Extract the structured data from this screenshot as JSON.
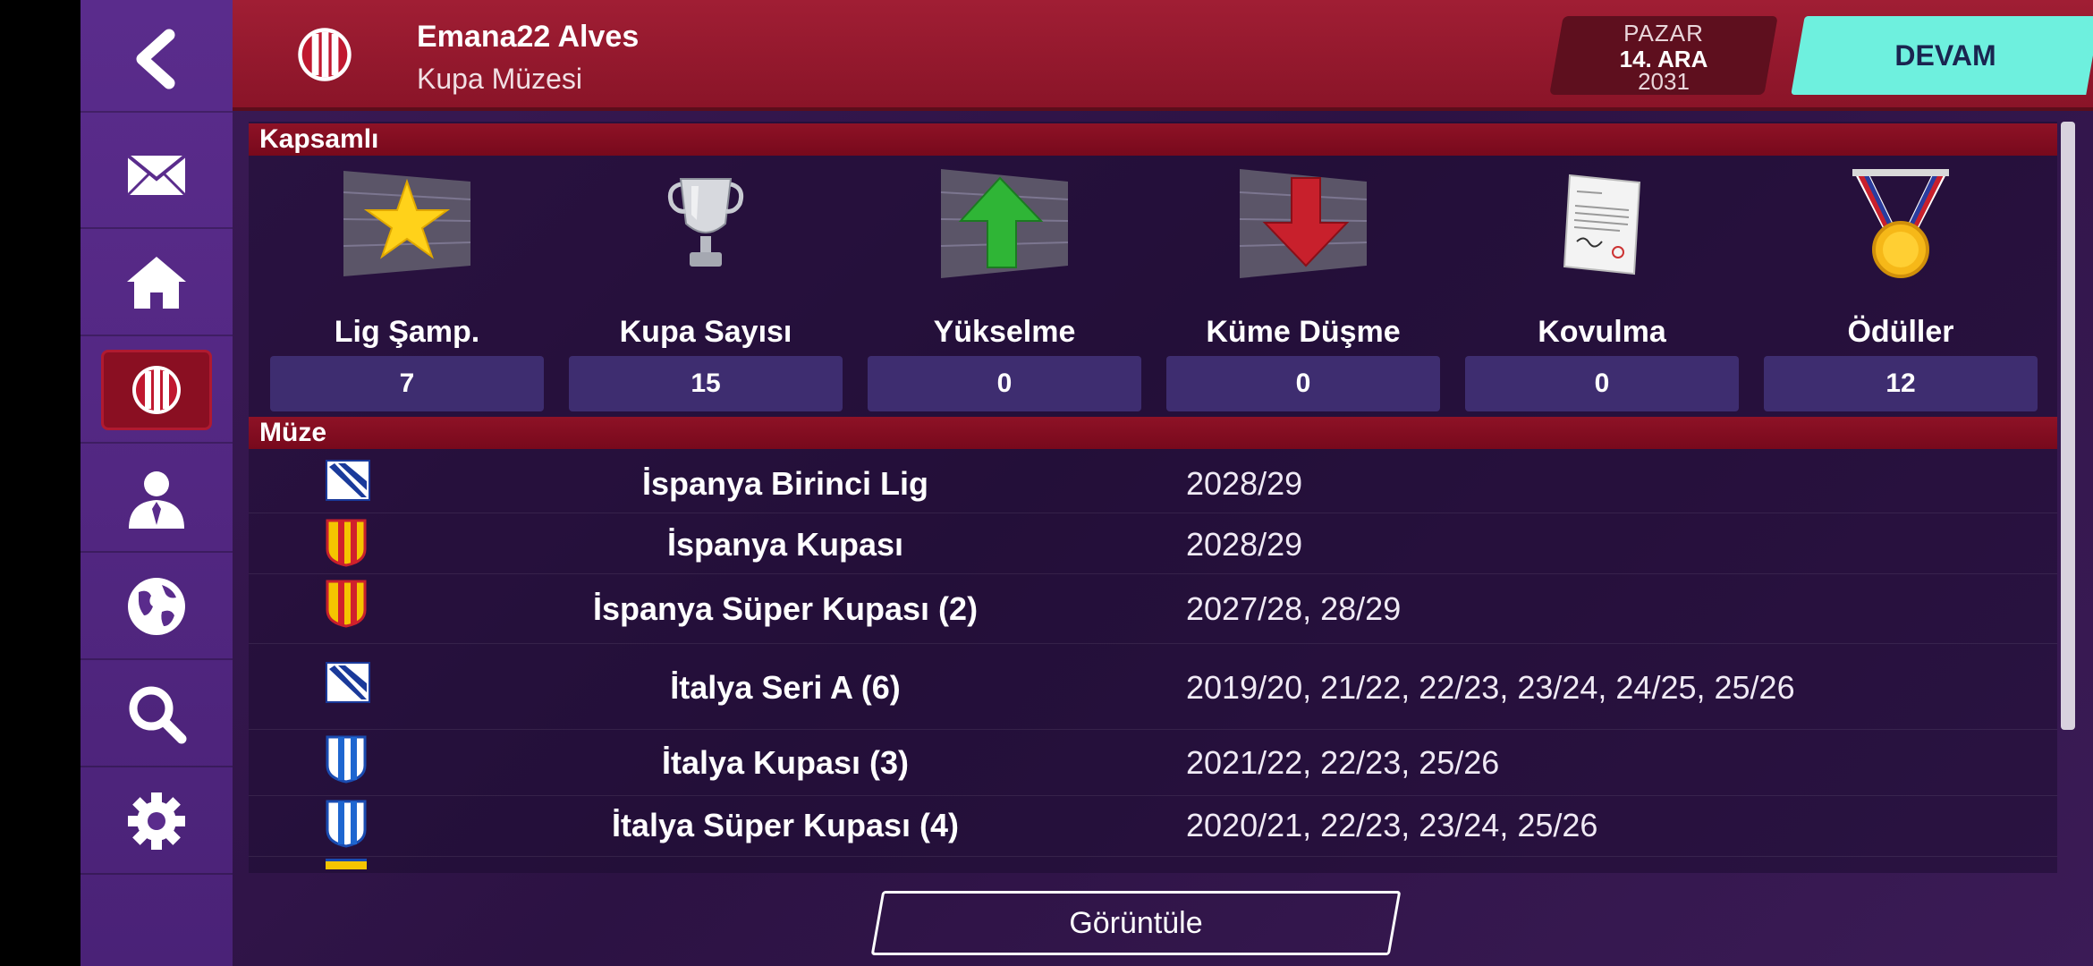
{
  "header": {
    "manager_name": "Emana22 Alves",
    "page_subtitle": "Kupa Müzesi",
    "date": {
      "day": "PAZAR",
      "date": "14. ARA",
      "year": "2031"
    },
    "continue_label": "DEVAM"
  },
  "sidebar": {
    "items": [
      {
        "icon": "back-arrow-icon"
      },
      {
        "icon": "mail-icon"
      },
      {
        "icon": "home-icon"
      },
      {
        "icon": "club-crest-icon",
        "active": true
      },
      {
        "icon": "manager-icon"
      },
      {
        "icon": "globe-icon"
      },
      {
        "icon": "search-icon"
      },
      {
        "icon": "gear-icon"
      }
    ]
  },
  "summary": {
    "section_title": "Kapsamlı",
    "stats": [
      {
        "label": "Lig Şamp.",
        "value": "7",
        "icon": "star-icon"
      },
      {
        "label": "Kupa Sayısı",
        "value": "15",
        "icon": "trophy-icon"
      },
      {
        "label": "Yükselme",
        "value": "0",
        "icon": "up-arrow-icon"
      },
      {
        "label": "Küme Düşme",
        "value": "0",
        "icon": "down-arrow-icon"
      },
      {
        "label": "Kovulma",
        "value": "0",
        "icon": "letter-icon"
      },
      {
        "label": "Ödüller",
        "value": "12",
        "icon": "medal-icon"
      }
    ]
  },
  "museum": {
    "section_title": "Müze",
    "rows": [
      {
        "name": "İspanya Birinci Lig",
        "years": "2028/29",
        "icon": "league-badge-icon"
      },
      {
        "name": "İspanya Kupası",
        "years": "2028/29",
        "icon": "cup-shield-red-yellow-icon"
      },
      {
        "name": "İspanya Süper Kupası (2)",
        "years": "2027/28, 28/29",
        "icon": "cup-shield-red-yellow-icon"
      },
      {
        "name": "İtalya Seri A (6)",
        "years": "2019/20, 21/22, 22/23, 23/24, 24/25, 25/26",
        "icon": "league-badge-icon"
      },
      {
        "name": "İtalya Kupası (3)",
        "years": "2021/22, 22/23, 25/26",
        "icon": "cup-shield-blue-white-icon"
      },
      {
        "name": "İtalya Süper Kupası (4)",
        "years": "2020/21, 22/23, 23/24, 25/26",
        "icon": "cup-shield-blue-white-icon"
      }
    ]
  },
  "footer": {
    "view_label": "Görüntüle"
  },
  "colors": {
    "topbar": "#a01e34",
    "sidebar": "#5a2c8c",
    "continue": "#6ef0de",
    "section_bar": "#8e1226",
    "stat_box": "#3e2d70"
  }
}
